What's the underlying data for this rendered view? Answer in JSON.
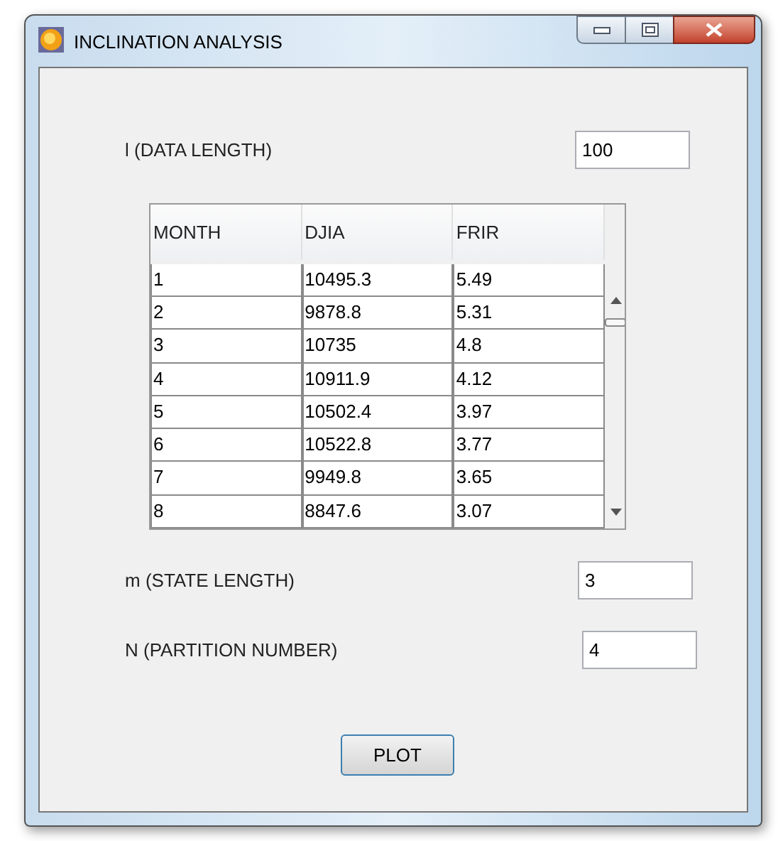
{
  "window": {
    "title": "INCLINATION ANALYSIS"
  },
  "data_length": {
    "label": "l (DATA LENGTH)",
    "value": "100"
  },
  "table": {
    "columns": [
      "MONTH",
      "DJIA",
      "FRIR"
    ],
    "rows": [
      [
        "1",
        "10495.3",
        "5.49"
      ],
      [
        "2",
        "9878.8",
        "5.31"
      ],
      [
        "3",
        "10735",
        "4.8"
      ],
      [
        "4",
        "10911.9",
        "4.12"
      ],
      [
        "5",
        "10502.4",
        "3.97"
      ],
      [
        "6",
        "10522.8",
        "3.77"
      ],
      [
        "7",
        "9949.8",
        "3.65"
      ],
      [
        "8",
        "8847.6",
        "3.07"
      ]
    ]
  },
  "state_length": {
    "label": "m (STATE LENGTH)",
    "value": "3"
  },
  "partition_number": {
    "label": "N (PARTITION NUMBER)",
    "value": "4"
  },
  "plot_button": "PLOT"
}
